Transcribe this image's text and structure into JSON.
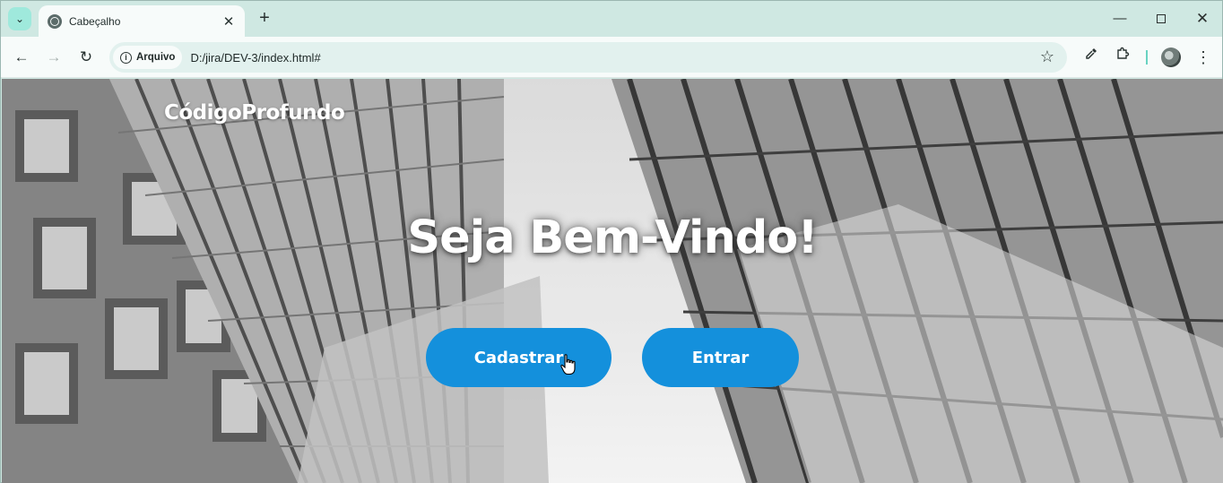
{
  "browser": {
    "tab": {
      "title": "Cabeçalho"
    },
    "omnibox": {
      "chip_label": "Arquivo",
      "url": "D:/jira/DEV-3/index.html#"
    },
    "colors": {
      "frame": "#cfe8e2",
      "toolbar": "#f7fbfa",
      "omnibox": "#e2f1ee"
    }
  },
  "page": {
    "brand": "CódigoProfundo",
    "hero_title": "Seja Bem-Vindo!",
    "buttons": {
      "register": "Cadastrar",
      "login": "Entrar"
    },
    "colors": {
      "button": "#1490dc",
      "text": "#ffffff"
    }
  }
}
